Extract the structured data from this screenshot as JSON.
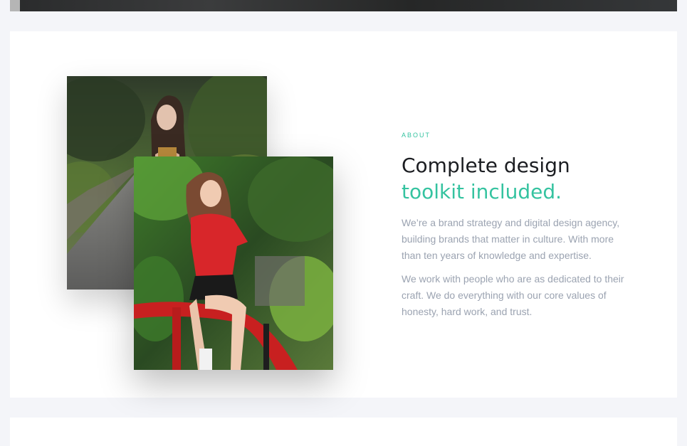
{
  "about": {
    "eyebrow": "ABOUT",
    "heading_line1": "Complete design",
    "heading_line2": "toolkit included.",
    "paragraph1": "We’re a brand strategy and digital design agency, building brands that matter in culture. With more than ten years of knowledge and expertise.",
    "paragraph2": "We work with people who are as dedicated to their craft. We do everything with our core values of honesty, hard work, and trust."
  },
  "colors": {
    "accent": "#35c3a0",
    "heading": "#1c1e22",
    "body_text": "#9ba3b1",
    "page_bg": "#f4f5f9",
    "card_bg": "#ffffff"
  }
}
